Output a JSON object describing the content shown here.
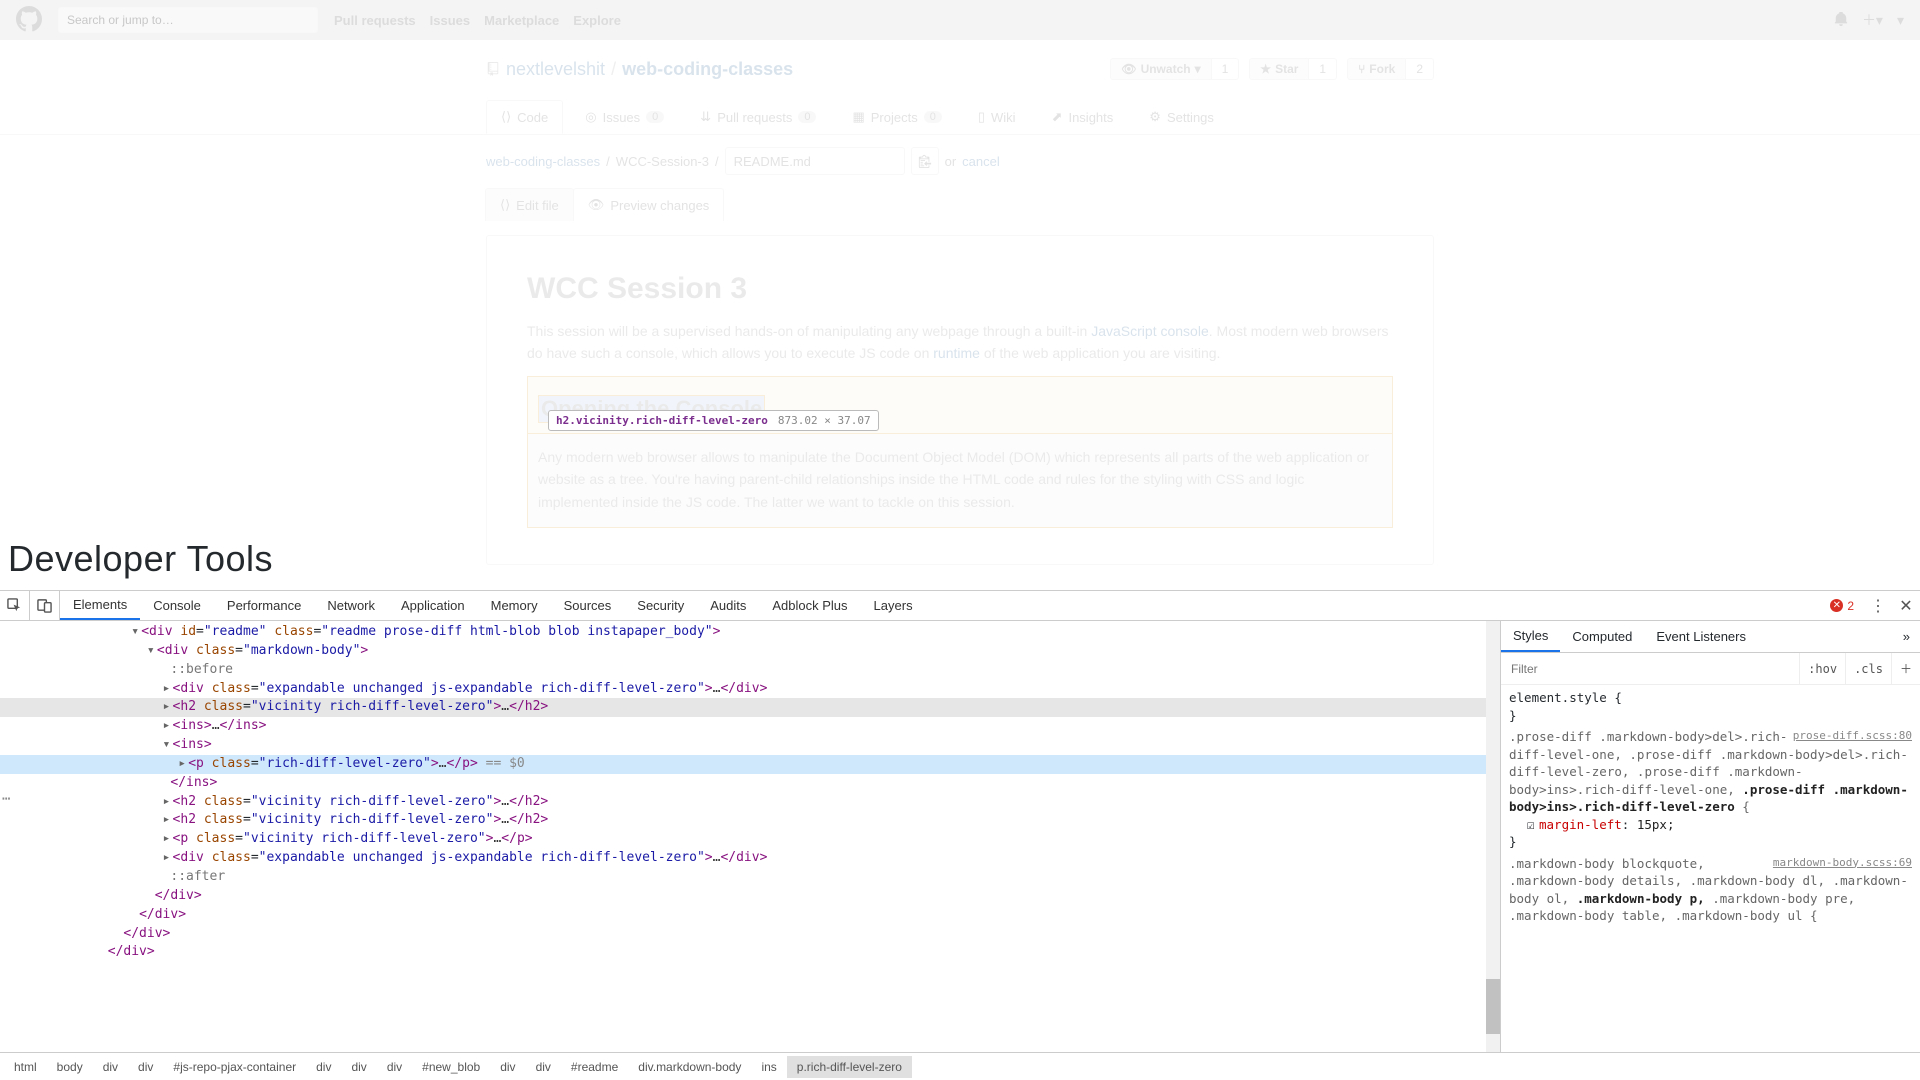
{
  "gh": {
    "search_placeholder": "Search or jump to…",
    "nav": [
      "Pull requests",
      "Issues",
      "Marketplace",
      "Explore"
    ]
  },
  "repo": {
    "owner": "nextlevelshit",
    "name": "web-coding-classes",
    "actions": {
      "unwatch": "Unwatch",
      "unwatch_count": "1",
      "star": "Star",
      "star_count": "1",
      "fork": "Fork",
      "fork_count": "2"
    },
    "tabs": {
      "code": "Code",
      "issues": "Issues",
      "issues_count": "0",
      "pulls": "Pull requests",
      "pulls_count": "0",
      "projects": "Projects",
      "projects_count": "0",
      "wiki": "Wiki",
      "insights": "Insights",
      "settings": "Settings"
    }
  },
  "file": {
    "crumb_root": "web-coding-classes",
    "crumb_folder": "WCC-Session-3",
    "filename": "README.md",
    "or": "or",
    "cancel": "cancel",
    "tab_edit": "Edit file",
    "tab_preview": "Preview changes"
  },
  "doc": {
    "title": "WCC Session 3",
    "p1a": "This session will be a supervised hands-on of manipulating any webpage through a built-in ",
    "p1l1": "JavaScript console",
    "p1b": ". Most modern web browsers do have such a console, which allows you to execute JS code on ",
    "p1l2": "runtime",
    "p1c": " of the web application you are visiting.",
    "h2": "Opening the Console",
    "p2": "Any modern web browser allows to manipulate the Document Object Model (DOM) which represents all parts of the web application or website as a tree. You're having parent-child relationships inside the HTML code and rules for the styling with CSS and logic implemented inside the JS code. The latter we want to tackle on this session."
  },
  "tooltip": {
    "selector": "h2.vicinity.rich-diff-level-zero",
    "dims": "873.02 × 37.07"
  },
  "dt_label": "Developer Tools",
  "devtools": {
    "tabs": [
      "Elements",
      "Console",
      "Performance",
      "Network",
      "Application",
      "Memory",
      "Sources",
      "Security",
      "Audits",
      "Adblock Plus",
      "Layers"
    ],
    "active_tab": "Elements",
    "errors": "2",
    "styles_tabs": [
      "Styles",
      "Computed",
      "Event Listeners"
    ],
    "filter_placeholder": "Filter",
    "hov": ":hov",
    "cls": ".cls",
    "css": {
      "inline": "element.style {",
      "sel1_dim": ".prose-diff .markdown-body>del>.rich-diff-level-one, .prose-diff .markdown-body>del>.rich-diff-level-zero, .prose-diff .markdown-body>ins>.rich-diff-level-one, ",
      "sel1_match": ".prose-diff .markdown-body>ins>.rich-diff-level-zero",
      "sel1_open": " {",
      "src1": "prose-diff.scss:80",
      "rule1_prop": "margin-left",
      "rule1_val": "15px;",
      "close": "}",
      "sel2_dim": ".markdown-body blockquote, .markdown-body details, .markdown-body dl, .markdown-body ol, ",
      "sel2_match": ".markdown-body p,",
      "sel2_dim2": " .markdown-body pre, .markdown-body table, .markdown-body ul {",
      "src2": "markdown-body.scss:69"
    },
    "crumbs": [
      "html",
      "body",
      "div",
      "div",
      "#js-repo-pjax-container",
      "div",
      "div",
      "div",
      "#new_blob",
      "div",
      "div",
      "#readme",
      "div.markdown-body",
      "ins",
      "p.rich-diff-level-zero"
    ]
  }
}
